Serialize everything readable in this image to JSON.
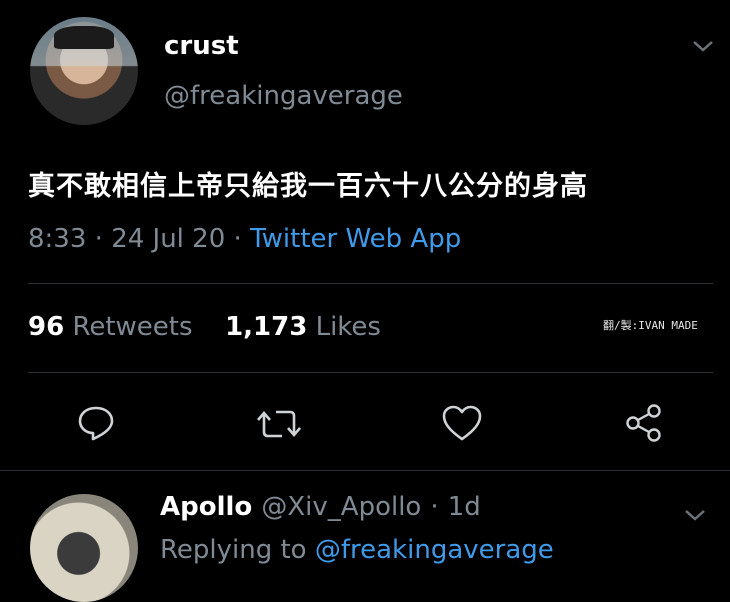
{
  "tweet": {
    "author_name": "crust",
    "author_handle": "@freakingaverage",
    "text": "真不敢相信上帝只給我一百六十八公分的身高",
    "time": "8:33",
    "date": "24 Jul 20",
    "source": "Twitter Web App",
    "retweets_count": "96",
    "retweets_label": "Retweets",
    "likes_count": "1,173",
    "likes_label": "Likes",
    "sep": "·"
  },
  "credit": "翻/製:IVAN MADE",
  "icons": [
    "chevron-down-icon",
    "reply-icon",
    "retweet-icon",
    "like-icon",
    "share-icon"
  ],
  "reply": {
    "author_name": "Apollo",
    "author_handle": "@Xiv_Apollo",
    "age": "1d",
    "replying_to_label": "Replying to",
    "replying_to_handle": "@freakingaverage"
  },
  "colors": {
    "background": "#000000",
    "link": "#3f9ae8",
    "muted": "#7f8a94"
  }
}
